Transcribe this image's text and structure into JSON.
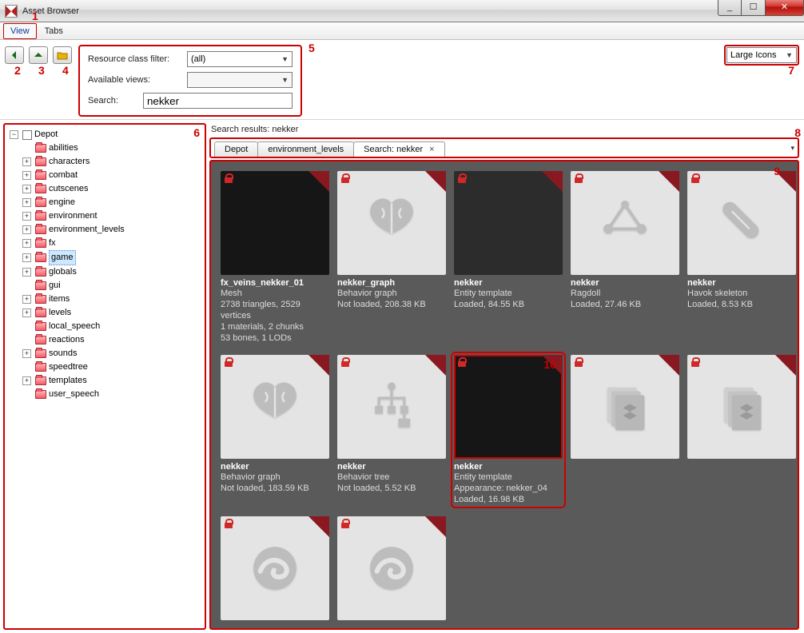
{
  "window": {
    "title": "Asset Browser"
  },
  "menu": {
    "view": "View",
    "tabs": "Tabs"
  },
  "filter": {
    "class_label": "Resource class filter:",
    "class_value": "(all)",
    "views_label": "Available views:",
    "search_label": "Search:",
    "search_value": "nekker"
  },
  "viewmode": {
    "value": "Large Icons"
  },
  "tree": {
    "root": "Depot",
    "items": [
      {
        "label": "abilities",
        "expandable": false
      },
      {
        "label": "characters",
        "expandable": true
      },
      {
        "label": "combat",
        "expandable": true
      },
      {
        "label": "cutscenes",
        "expandable": true
      },
      {
        "label": "engine",
        "expandable": true
      },
      {
        "label": "environment",
        "expandable": true
      },
      {
        "label": "environment_levels",
        "expandable": true
      },
      {
        "label": "fx",
        "expandable": true
      },
      {
        "label": "game",
        "expandable": true,
        "selected": true
      },
      {
        "label": "globals",
        "expandable": true
      },
      {
        "label": "gui",
        "expandable": false
      },
      {
        "label": "items",
        "expandable": true
      },
      {
        "label": "levels",
        "expandable": true
      },
      {
        "label": "local_speech",
        "expandable": false
      },
      {
        "label": "reactions",
        "expandable": false
      },
      {
        "label": "sounds",
        "expandable": true
      },
      {
        "label": "speedtree",
        "expandable": false
      },
      {
        "label": "templates",
        "expandable": true
      },
      {
        "label": "user_speech",
        "expandable": false
      }
    ]
  },
  "results_header": "Search results: nekker",
  "tabs": [
    {
      "label": "Depot",
      "closable": false
    },
    {
      "label": "environment_levels",
      "closable": false
    },
    {
      "label": "Search: nekker",
      "closable": true,
      "active": true
    }
  ],
  "cards": [
    {
      "name": "fx_veins_nekker_01",
      "type": "Mesh",
      "extra": [
        "2738 triangles, 2529 vertices",
        "1 materials, 2 chunks",
        "53 bones, 1 LODs"
      ],
      "icon": "dark"
    },
    {
      "name": "nekker_graph",
      "type": "Behavior graph",
      "status": "Not loaded, 208.38 KB",
      "icon": "brain"
    },
    {
      "name": "nekker",
      "type": "Entity template",
      "status": "Loaded, 84.55 KB",
      "icon": "dark2"
    },
    {
      "name": "nekker",
      "type": "Ragdoll",
      "status": "Loaded, 27.46 KB",
      "icon": "ragdoll"
    },
    {
      "name": "nekker",
      "type": "Havok skeleton",
      "status": "Loaded, 8.53 KB",
      "icon": "skeleton"
    },
    {
      "name": "nekker",
      "type": "Behavior graph",
      "status": "Not loaded, 183.59 KB",
      "icon": "brain"
    },
    {
      "name": "nekker",
      "type": "Behavior tree",
      "status": "Not loaded, 5.52 KB",
      "icon": "tree"
    },
    {
      "name": "nekker",
      "type": "Entity template",
      "extra": [
        "Appearance: nekker_04",
        "Loaded, 16.98 KB"
      ],
      "icon": "dark",
      "highlight": true
    },
    {
      "name": "",
      "type": "",
      "icon": "stack"
    },
    {
      "name": "",
      "type": "",
      "icon": "stack"
    },
    {
      "name": "",
      "type": "",
      "icon": "swirl"
    },
    {
      "name": "",
      "type": "",
      "icon": "swirl"
    }
  ],
  "callouts": {
    "c1": "1",
    "c2": "2",
    "c3": "3",
    "c4": "4",
    "c5": "5",
    "c6": "6",
    "c7": "7",
    "c8": "8",
    "c9": "9",
    "c10": "10"
  }
}
